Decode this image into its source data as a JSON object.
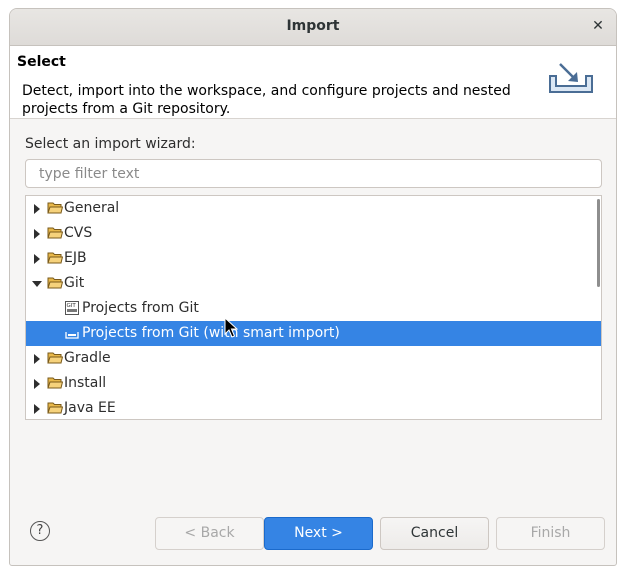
{
  "dialog": {
    "title": "Import",
    "close_icon": "close-icon"
  },
  "header": {
    "title": "Select",
    "description": "Detect, import into the workspace, and configure projects and nested projects from a Git repository.",
    "icon": "import-wizard-icon"
  },
  "wizard": {
    "label": "Select an import wizard:",
    "filter_placeholder": "type filter text",
    "filter_value": ""
  },
  "tree": {
    "items": [
      {
        "label": "General",
        "level": 0,
        "expanded": false,
        "icon": "folder-icon",
        "selected": false
      },
      {
        "label": "CVS",
        "level": 0,
        "expanded": false,
        "icon": "folder-icon",
        "selected": false
      },
      {
        "label": "EJB",
        "level": 0,
        "expanded": false,
        "icon": "folder-icon",
        "selected": false
      },
      {
        "label": "Git",
        "level": 0,
        "expanded": true,
        "icon": "folder-icon",
        "selected": false
      },
      {
        "label": "Projects from Git",
        "level": 1,
        "icon": "git-projects-icon",
        "selected": false
      },
      {
        "label": "Projects from Git (with smart import)",
        "level": 1,
        "icon": "git-smart-import-icon",
        "selected": true
      },
      {
        "label": "Gradle",
        "level": 0,
        "expanded": false,
        "icon": "folder-icon",
        "selected": false
      },
      {
        "label": "Install",
        "level": 0,
        "expanded": false,
        "icon": "folder-icon",
        "selected": false
      },
      {
        "label": "Java EE",
        "level": 0,
        "expanded": false,
        "icon": "folder-icon",
        "selected": false
      }
    ]
  },
  "buttons": {
    "help": "?",
    "back": "< Back",
    "next": "Next >",
    "cancel": "Cancel",
    "finish": "Finish"
  },
  "colors": {
    "selection": "#3584e4",
    "folder": "#e8b84a"
  }
}
